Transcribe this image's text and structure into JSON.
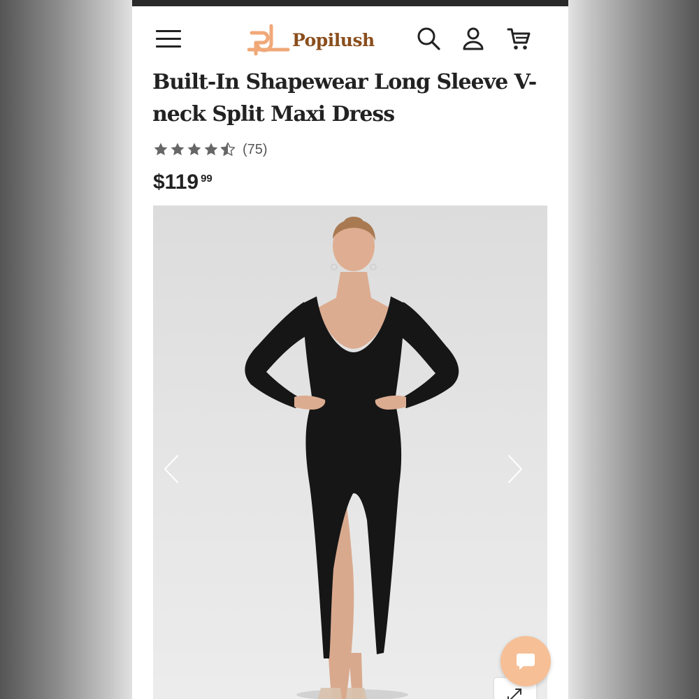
{
  "header": {
    "brand": "Popilush",
    "brand_color": "#8a4e1c",
    "logo_accent_color": "#f0a878",
    "icons": [
      "menu-icon",
      "search-icon",
      "account-icon",
      "cart-icon"
    ]
  },
  "product": {
    "title": "Built-In Shapewear Long Sleeve V-neck Split Maxi Dress",
    "rating": 4.5,
    "rating_max": 5,
    "review_count": "(75)",
    "price_main": "$119",
    "price_cents": "99"
  },
  "gallery": {
    "image_subject": "model in black long sleeve split maxi dress",
    "controls": [
      "chevron-left-icon",
      "chevron-right-icon",
      "expand-icon"
    ]
  },
  "chat": {
    "icon": "chat-bubble-icon",
    "color": "#f6bf96"
  }
}
